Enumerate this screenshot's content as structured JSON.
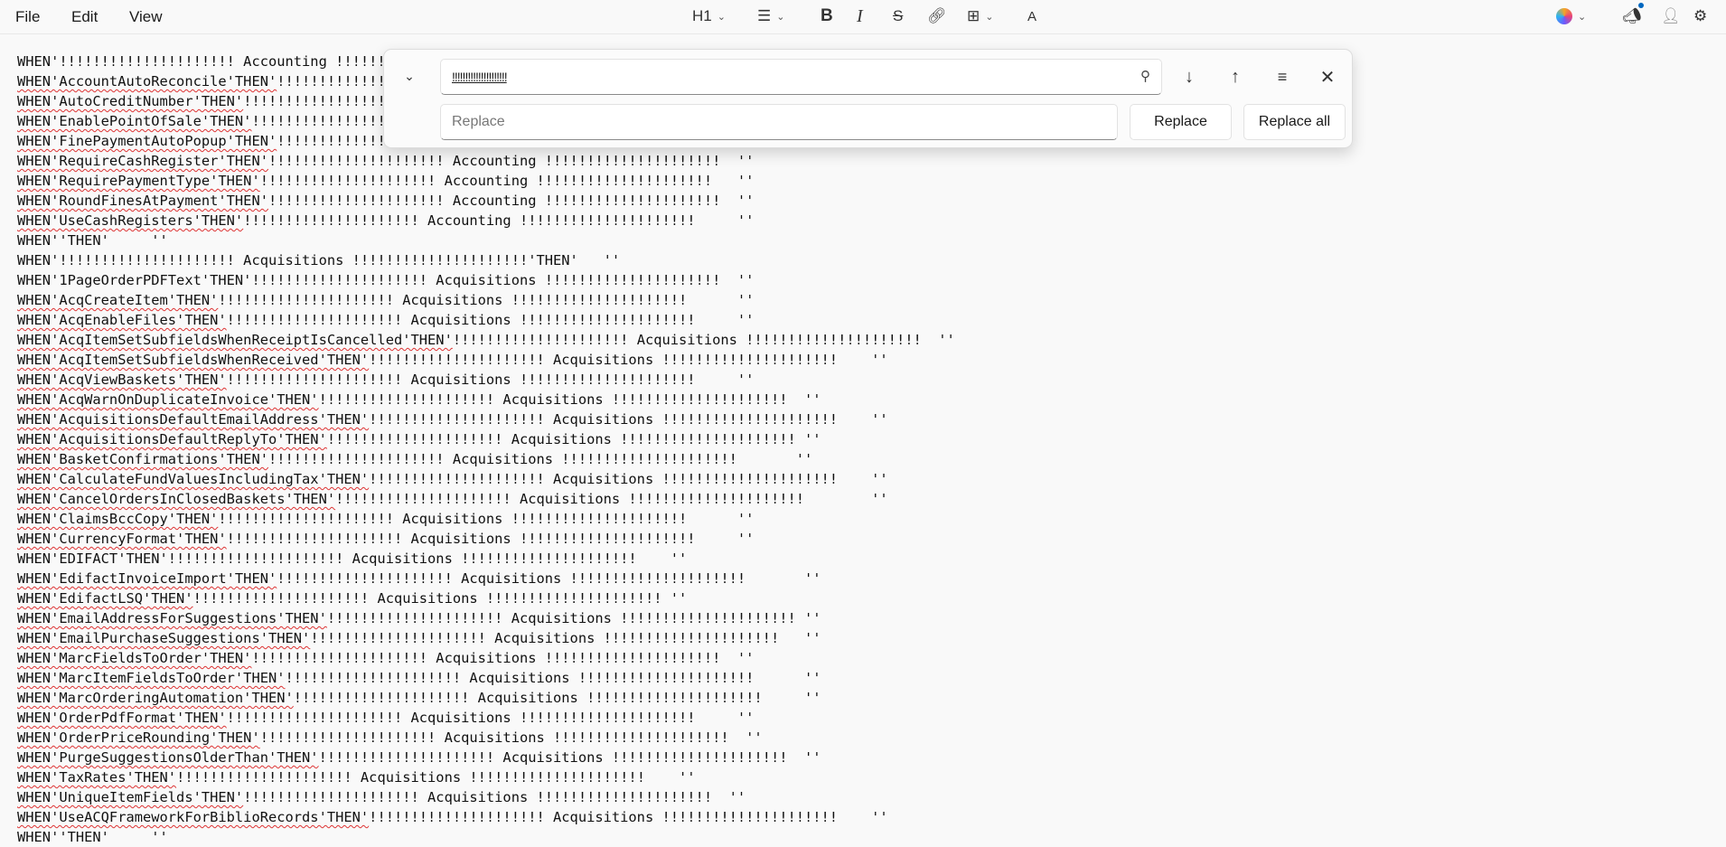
{
  "menu": {
    "file": "File",
    "edit": "Edit",
    "view": "View"
  },
  "toolbar": {
    "heading": "H1",
    "bold": "B",
    "italic": "I",
    "strike": "S",
    "spell": "A"
  },
  "find": {
    "query": "!!!!!!!!!!!!!!!!!!!!!",
    "replace_placeholder": "Replace",
    "replace_label": "Replace",
    "replace_all_label": "Replace all"
  },
  "lines": [
    [
      "WHEN'!!!!!!!!!!!!!!!!!!!!! Accounting !!!!!!!!!!!!!!!!!!!!!'THEN'   ''",
      ""
    ],
    [
      "WHEN'AccountAutoReconcile'THEN'",
      "!!!!!!!!!!!!!!!!!!!!! Accounting !!!!!!!!!!!!!!!!!!!!!  ''"
    ],
    [
      "WHEN'AutoCreditNumber'THEN'",
      "!!!!!!!!!!!!!!!!!!!!! Accounting !!!!!!!!!!!!!!!!!!!!!      ''"
    ],
    [
      "WHEN'EnablePointOfSale'THEN'",
      "!!!!!!!!!!!!!!!!!!!!! Accounting !!!!!!!!!!!!!!!!!!!!!     ''"
    ],
    [
      "WHEN'FinePaymentAutoPopup'THEN'",
      "!!!!!!!!!!!!!!!!!!!!! Accounting !!!!!!!!!!!!!!!!!!!!!  ''"
    ],
    [
      "WHEN'RequireCashRegister'THEN'",
      "!!!!!!!!!!!!!!!!!!!!! Accounting !!!!!!!!!!!!!!!!!!!!!  ''"
    ],
    [
      "WHEN'RequirePaymentType'THEN'",
      "!!!!!!!!!!!!!!!!!!!!! Accounting !!!!!!!!!!!!!!!!!!!!!   ''"
    ],
    [
      "WHEN'RoundFinesAtPayment'THEN'",
      "!!!!!!!!!!!!!!!!!!!!! Accounting !!!!!!!!!!!!!!!!!!!!!  ''"
    ],
    [
      "WHEN'UseCashRegisters'THEN'",
      "!!!!!!!!!!!!!!!!!!!!! Accounting !!!!!!!!!!!!!!!!!!!!!     ''"
    ],
    [
      "WHEN''THEN'     ''",
      ""
    ],
    [
      "WHEN'!!!!!!!!!!!!!!!!!!!!! Acquisitions !!!!!!!!!!!!!!!!!!!!!'THEN'   ''",
      ""
    ],
    [
      "WHEN'1PageOrderPDFText'THEN'!!!!!!!!!!!!!!!!!!!!! Acquisitions !!!!!!!!!!!!!!!!!!!!!  ''",
      ""
    ],
    [
      "WHEN'AcqCreateItem'THEN'",
      "!!!!!!!!!!!!!!!!!!!!! Acquisitions !!!!!!!!!!!!!!!!!!!!!      ''"
    ],
    [
      "WHEN'AcqEnableFiles'THEN'",
      "!!!!!!!!!!!!!!!!!!!!! Acquisitions !!!!!!!!!!!!!!!!!!!!!     ''"
    ],
    [
      "WHEN'AcqItemSetSubfieldsWhenReceiptIsCancelled'THEN'",
      "!!!!!!!!!!!!!!!!!!!!! Acquisitions !!!!!!!!!!!!!!!!!!!!!  ''"
    ],
    [
      "WHEN'AcqItemSetSubfieldsWhenReceived'THEN'",
      "!!!!!!!!!!!!!!!!!!!!! Acquisitions !!!!!!!!!!!!!!!!!!!!!    ''"
    ],
    [
      "WHEN'AcqViewBaskets'THEN'",
      "!!!!!!!!!!!!!!!!!!!!! Acquisitions !!!!!!!!!!!!!!!!!!!!!     ''"
    ],
    [
      "WHEN'AcqWarnOnDuplicateInvoice'THEN'",
      "!!!!!!!!!!!!!!!!!!!!! Acquisitions !!!!!!!!!!!!!!!!!!!!!  ''"
    ],
    [
      "WHEN'AcquisitionsDefaultEmailAddress'THEN'",
      "!!!!!!!!!!!!!!!!!!!!! Acquisitions !!!!!!!!!!!!!!!!!!!!!    ''"
    ],
    [
      "WHEN'AcquisitionsDefaultReplyTo'THEN'",
      "!!!!!!!!!!!!!!!!!!!!! Acquisitions !!!!!!!!!!!!!!!!!!!!! ''"
    ],
    [
      "WHEN'BasketConfirmations'THEN'",
      "!!!!!!!!!!!!!!!!!!!!! Acquisitions !!!!!!!!!!!!!!!!!!!!!       ''"
    ],
    [
      "WHEN'CalculateFundValuesIncludingTax'THEN'",
      "!!!!!!!!!!!!!!!!!!!!! Acquisitions !!!!!!!!!!!!!!!!!!!!!    ''"
    ],
    [
      "WHEN'CancelOrdersInClosedBaskets'THEN'",
      "!!!!!!!!!!!!!!!!!!!!! Acquisitions !!!!!!!!!!!!!!!!!!!!!        ''"
    ],
    [
      "WHEN'ClaimsBccCopy'THEN'",
      "!!!!!!!!!!!!!!!!!!!!! Acquisitions !!!!!!!!!!!!!!!!!!!!!      ''"
    ],
    [
      "WHEN'CurrencyFormat'THEN'",
      "!!!!!!!!!!!!!!!!!!!!! Acquisitions !!!!!!!!!!!!!!!!!!!!!     ''"
    ],
    [
      "WHEN'EDIFACT'THEN'!!!!!!!!!!!!!!!!!!!!! Acquisitions !!!!!!!!!!!!!!!!!!!!!    ''",
      ""
    ],
    [
      "WHEN'EdifactInvoiceImport'THEN'",
      "!!!!!!!!!!!!!!!!!!!!! Acquisitions !!!!!!!!!!!!!!!!!!!!!       ''"
    ],
    [
      "WHEN'EdifactLSQ'THEN'",
      "!!!!!!!!!!!!!!!!!!!!! Acquisitions !!!!!!!!!!!!!!!!!!!!! ''"
    ],
    [
      "WHEN'EmailAddressForSuggestions'THEN'",
      "!!!!!!!!!!!!!!!!!!!!! Acquisitions !!!!!!!!!!!!!!!!!!!!! ''"
    ],
    [
      "WHEN'EmailPurchaseSuggestions'THEN'",
      "!!!!!!!!!!!!!!!!!!!!! Acquisitions !!!!!!!!!!!!!!!!!!!!!   ''"
    ],
    [
      "WHEN'MarcFieldsToOrder'THEN'",
      "!!!!!!!!!!!!!!!!!!!!! Acquisitions !!!!!!!!!!!!!!!!!!!!!  ''"
    ],
    [
      "WHEN'MarcItemFieldsToOrder'THEN'",
      "!!!!!!!!!!!!!!!!!!!!! Acquisitions !!!!!!!!!!!!!!!!!!!!!      ''"
    ],
    [
      "WHEN'MarcOrderingAutomation'THEN'",
      "!!!!!!!!!!!!!!!!!!!!! Acquisitions !!!!!!!!!!!!!!!!!!!!!     ''"
    ],
    [
      "WHEN'OrderPdfFormat'THEN'",
      "!!!!!!!!!!!!!!!!!!!!! Acquisitions !!!!!!!!!!!!!!!!!!!!!     ''"
    ],
    [
      "WHEN'OrderPriceRounding'THEN'",
      "!!!!!!!!!!!!!!!!!!!!! Acquisitions !!!!!!!!!!!!!!!!!!!!!  ''"
    ],
    [
      "WHEN'PurgeSuggestionsOlderThan'THEN'",
      "!!!!!!!!!!!!!!!!!!!!! Acquisitions !!!!!!!!!!!!!!!!!!!!!  ''"
    ],
    [
      "WHEN'TaxRates'THEN'",
      "!!!!!!!!!!!!!!!!!!!!! Acquisitions !!!!!!!!!!!!!!!!!!!!!    ''"
    ],
    [
      "WHEN'UniqueItemFields'THEN'",
      "!!!!!!!!!!!!!!!!!!!!! Acquisitions !!!!!!!!!!!!!!!!!!!!!  ''"
    ],
    [
      "WHEN'UseACQFrameworkForBiblioRecords'THEN'",
      "!!!!!!!!!!!!!!!!!!!!! Acquisitions !!!!!!!!!!!!!!!!!!!!!    ''"
    ],
    [
      "WHEN''THEN'     ''",
      ""
    ]
  ]
}
